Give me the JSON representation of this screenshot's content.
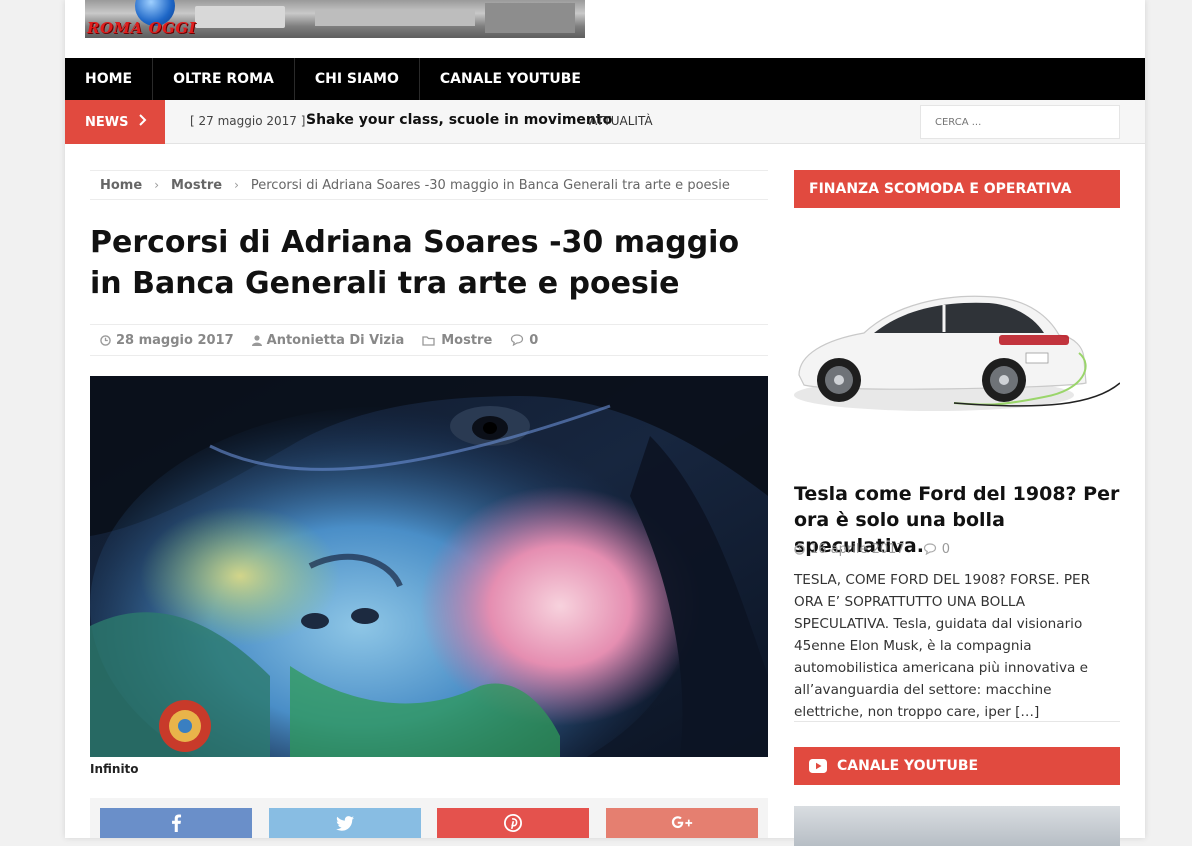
{
  "header": {
    "logo_text": "ROMA OGGI"
  },
  "nav": {
    "items": [
      "HOME",
      "OLTRE ROMA",
      "CHI SIAMO",
      "CANALE YOUTUBE"
    ]
  },
  "ticker": {
    "label": "NEWS",
    "date": "[ 27 maggio 2017 ]",
    "title": "Shake your class, scuole in movimento",
    "category": "ATTUALITÀ",
    "search_placeholder": "CERCA ..."
  },
  "breadcrumb": {
    "home": "Home",
    "section": "Mostre",
    "current": "Percorsi di Adriana Soares -30 maggio in Banca Generali tra arte e poesie"
  },
  "article": {
    "title": "Percorsi di Adriana Soares -30 maggio in Banca Generali tra arte e poesie",
    "date": "28 maggio 2017",
    "author": "Antonietta Di Vizia",
    "category": "Mostre",
    "comments": "0",
    "image_caption": "Infinito"
  },
  "share": {
    "icons": [
      "facebook-icon",
      "twitter-icon",
      "pinterest-icon",
      "google-plus-icon"
    ],
    "colors": [
      "#6a8fc9",
      "#88bde3",
      "#e4524d",
      "#e57f70"
    ]
  },
  "sidebar": {
    "widget1_title": "FINANZA SCOMODA E OPERATIVA",
    "post_title": "Tesla come Ford del 1908? Per ora è solo una bolla speculativa.",
    "post_date": "16 aprile 2017",
    "post_comments": "0",
    "excerpt": "TESLA, COME FORD DEL 1908? FORSE. PER ORA E’ SOPRATTUTTO UNA BOLLA SPECULATIVA. Tesla, guidata dal visionario 45enne Elon Musk, è la compagnia automobilistica americana più innovativa e all’avanguardia del settore: macchine elettriche, non  troppo care, iper",
    "more": "[…]",
    "widget2_title": "CANALE YOUTUBE"
  },
  "colors": {
    "accent": "#e14a3f",
    "nav_bg": "#000000"
  }
}
